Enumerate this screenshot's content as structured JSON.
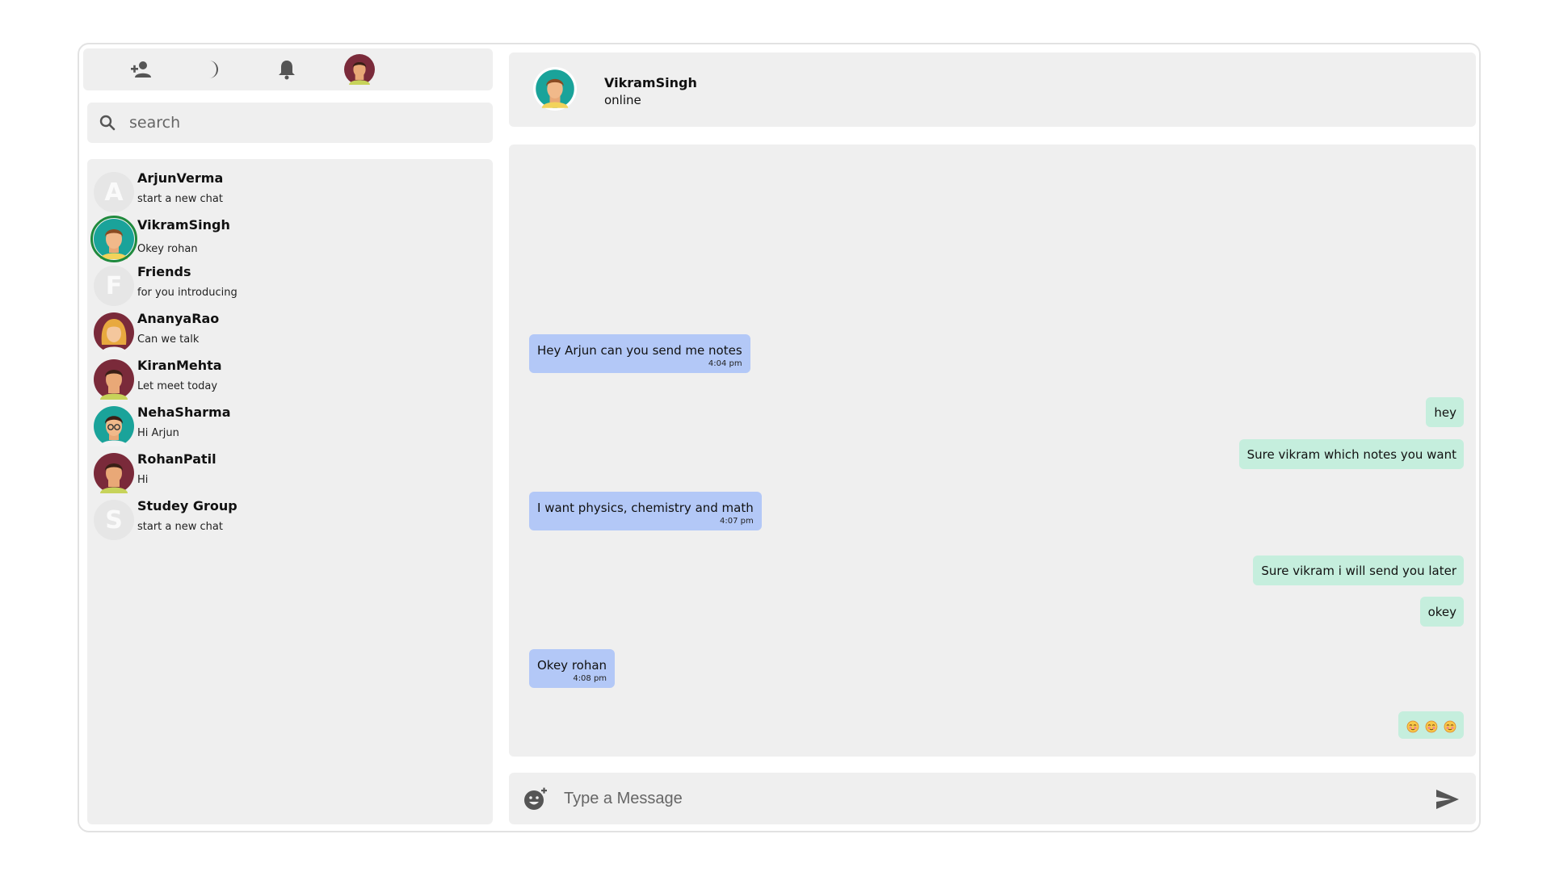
{
  "topbar": {
    "icons": [
      "add-person-icon",
      "moon-icon",
      "bell-icon",
      "profile-avatar"
    ]
  },
  "search": {
    "placeholder": "search"
  },
  "contacts": [
    {
      "name": "ArjunVerma",
      "last_message": "start a new chat",
      "avatar": "letter",
      "letter": "A"
    },
    {
      "name": "VikramSingh",
      "last_message": "Okey rohan",
      "avatar": "teal-man",
      "active": true
    },
    {
      "name": "Friends",
      "last_message": "for you introducing",
      "avatar": "letter",
      "letter": "F"
    },
    {
      "name": "AnanyaRao",
      "last_message": "Can we talk",
      "avatar": "blonde-woman"
    },
    {
      "name": "KiranMehta",
      "last_message": "Let meet today",
      "avatar": "maroon-man"
    },
    {
      "name": "NehaSharma",
      "last_message": "Hi Arjun",
      "avatar": "teal-glasses"
    },
    {
      "name": "RohanPatil",
      "last_message": "Hi",
      "avatar": "maroon-man"
    },
    {
      "name": "Studey Group",
      "last_message": "start a new chat",
      "avatar": "letter",
      "letter": "S"
    }
  ],
  "chat_header": {
    "name": "VikramSingh",
    "status": "online"
  },
  "messages": [
    {
      "direction": "incoming",
      "text": "Hey Arjun can you send me notes",
      "time": "4:04 pm"
    },
    {
      "direction": "outgoing",
      "text": "hey"
    },
    {
      "direction": "outgoing",
      "text": "Sure vikram which notes you want"
    },
    {
      "direction": "incoming",
      "text": "I want physics, chemistry and math",
      "time": "4:07 pm"
    },
    {
      "direction": "outgoing",
      "text": "Sure vikram i will send you later"
    },
    {
      "direction": "outgoing",
      "text": "okey"
    },
    {
      "direction": "incoming",
      "text": "Okey rohan",
      "time": "4:08 pm"
    },
    {
      "direction": "outgoing",
      "emojis": [
        "blushing-face-icon",
        "blushing-face-icon",
        "blushing-face-icon"
      ]
    }
  ],
  "composer": {
    "placeholder": "Type a Message"
  },
  "colors": {
    "panel": "#efefef",
    "incoming_bubble": "#b3c8f7",
    "outgoing_bubble": "#c5eedd",
    "active_ring": "#1f8a3d"
  }
}
